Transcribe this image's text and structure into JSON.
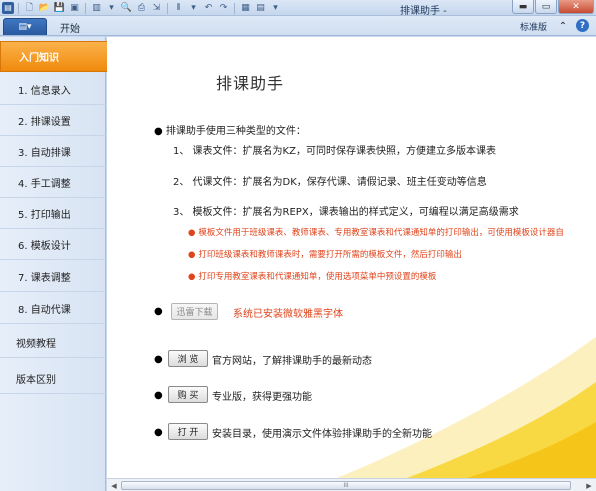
{
  "window": {
    "title": "排课助手 -",
    "minimize": "▬",
    "maximize": "▭",
    "close": "✕"
  },
  "ribbon": {
    "file_tab": "▤▾",
    "tabs": [
      {
        "label": "开始"
      }
    ],
    "edition_label": "标准版",
    "help": "?"
  },
  "sidebar": {
    "items": [
      {
        "label": "入门知识",
        "active": true
      },
      {
        "label": "1. 信息录入"
      },
      {
        "label": "2. 排课设置"
      },
      {
        "label": "3. 自动排课"
      },
      {
        "label": "4. 手工调整"
      },
      {
        "label": "5. 打印输出"
      },
      {
        "label": "6. 模板设计"
      },
      {
        "label": "7. 课表调整"
      },
      {
        "label": "8. 自动代课"
      },
      {
        "label": "视频教程"
      },
      {
        "label": "版本区别"
      }
    ]
  },
  "main": {
    "title": "排课助手",
    "intro": "排课助手使用三种类型的文件：",
    "file_types": [
      "1、 课表文件：扩展名为KZ，可同时保存课表快照，方便建立多版本课表",
      "2、 代课文件：扩展名为DK，保存代课、请假记录、班主任变动等信息",
      "3、 模板文件：扩展名为REPX，课表输出的样式定义，可编程以满足高级需求"
    ],
    "template_notes": [
      "模板文件用于班级课表、教师课表、专用教室课表和代课通知单的打印输出，可使用模板设计器自",
      "打印班级课表和教师课表时，需要打开所需的模板文件，然后打印输出",
      "打印专用教室课表和代课通知单，使用选项菜单中预设置的模板"
    ],
    "download_button": "迅雷下载",
    "font_note": "系统已安装微软雅黑字体",
    "browse_button": "浏 览",
    "browse_text": "官方网站，了解排课助手的最新动态",
    "buy_button": "购 买",
    "buy_text": "专业版，获得更强功能",
    "open_button": "打 开",
    "open_text": "安装目录，使用演示文件体验排课助手的全新功能"
  },
  "scrollbar": {
    "grip": "III",
    "left_arrow": "◀",
    "right_arrow": "▶"
  },
  "colors": {
    "accent": "#f08a0c",
    "note_red": "#e0441c",
    "swoosh_yellow": "#f7d21a"
  }
}
